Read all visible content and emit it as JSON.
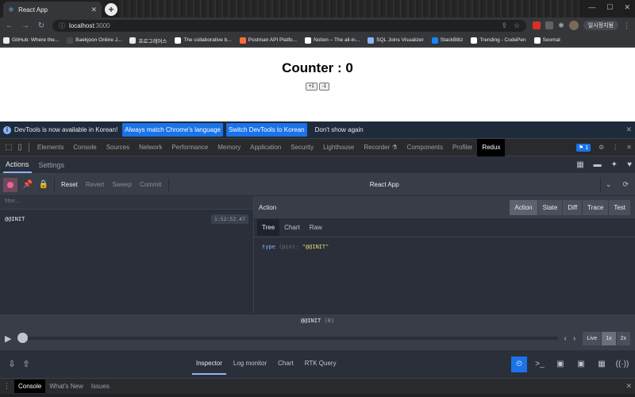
{
  "browser": {
    "tab_title": "React App",
    "url_host": "localhost",
    "url_port": ":3000",
    "profile_label": "일시정지됨",
    "bookmarks": [
      {
        "label": "GitHub: Where the...",
        "color": "#e8eaed"
      },
      {
        "label": "Baekjoon Online J...",
        "color": "#4a4a4a"
      },
      {
        "label": "프로그래머스",
        "color": "#e8eaed"
      },
      {
        "label": "The collaborative b...",
        "color": "#ffffff"
      },
      {
        "label": "Postman API Platfo...",
        "color": "#ff6c37"
      },
      {
        "label": "Notion – The all-in...",
        "color": "#ffffff"
      },
      {
        "label": "SQL Joins Visualizer",
        "color": "#8ab4f8"
      },
      {
        "label": "StackBlitz",
        "color": "#1389fd"
      },
      {
        "label": "Trending - CodePen",
        "color": "#ffffff"
      },
      {
        "label": "Seomal",
        "color": "#ffffff"
      }
    ]
  },
  "app": {
    "heading": "Counter : 0",
    "increment_label": "+1",
    "decrement_label": "-1"
  },
  "infobar": {
    "message": "DevTools is now available in Korean!",
    "btn_match": "Always match Chrome's language",
    "btn_switch": "Switch DevTools to Korean",
    "dont_show": "Don't show again"
  },
  "devtools": {
    "tabs": [
      "Elements",
      "Console",
      "Sources",
      "Network",
      "Performance",
      "Memory",
      "Application",
      "Security",
      "Lighthouse",
      "Recorder ⚗",
      "Components",
      "Profiler",
      "Redux"
    ],
    "active_tab": "Redux",
    "issues_badge": "1"
  },
  "redux": {
    "subtabs": [
      "Actions",
      "Settings"
    ],
    "toolbar": {
      "reset": "Reset",
      "revert": "Revert",
      "sweep": "Sweep",
      "commit": "Commit",
      "instance": "React App"
    },
    "filter_placeholder": "filter...",
    "actions": [
      {
        "name": "@@INIT",
        "time": "1:52:52.47"
      }
    ],
    "panel_title": "Action",
    "modes": [
      "Action",
      "State",
      "Diff",
      "Trace",
      "Test"
    ],
    "active_mode": "Action",
    "view_tabs": [
      "Tree",
      "Chart",
      "Raw"
    ],
    "active_view": "Tree",
    "tree": {
      "key": "type",
      "type_hint": "(pin)",
      "value": "\"@@INIT\""
    },
    "slider_label": "@@INIT",
    "slider_count": "(0)",
    "slider_progress": 0,
    "speeds": [
      "Live",
      "1x",
      "2x"
    ],
    "active_speed": "1x",
    "footer_tabs": [
      "Inspector",
      "Log monitor",
      "Chart",
      "RTK Query"
    ],
    "active_footer_tab": "Inspector"
  },
  "drawer": {
    "tabs": [
      "Console",
      "What's New",
      "Issues"
    ],
    "active": "Console"
  }
}
